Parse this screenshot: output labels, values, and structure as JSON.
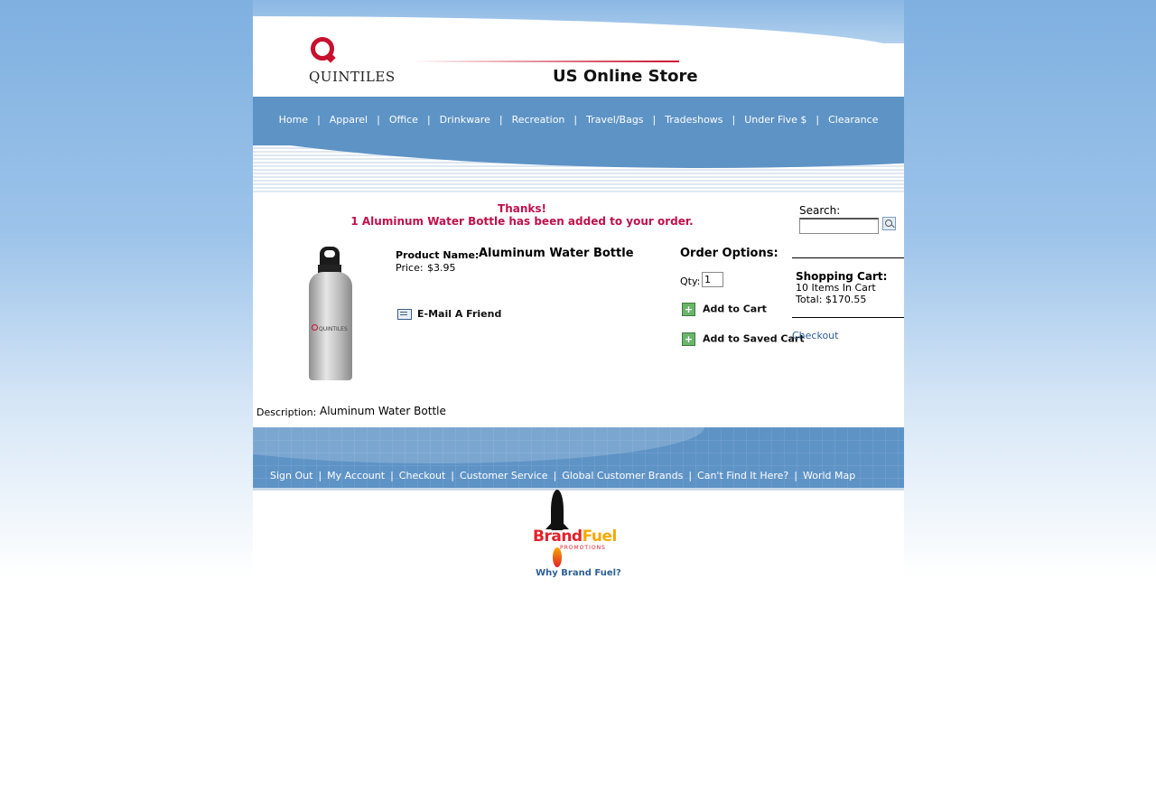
{
  "header": {
    "logo_text": "QUINTILES",
    "store_title": "US Online Store"
  },
  "nav": {
    "items": [
      "Home",
      "Apparel",
      "Office",
      "Drinkware",
      "Recreation",
      "Travel/Bags",
      "Tradeshows",
      "Under Five $",
      "Clearance"
    ],
    "separator": "|"
  },
  "confirmation": {
    "line1": "Thanks!",
    "line2": "1 Aluminum Water Bottle has been added to your order."
  },
  "product": {
    "name_label": "Product Name:",
    "name": "Aluminum Water Bottle",
    "price_label": "Price:",
    "price": "$3.95",
    "image_brand": "QUINTILES",
    "email_friend": "E-Mail A Friend",
    "description_label": "Description:",
    "description": "Aluminum Water Bottle"
  },
  "order_options": {
    "title": "Order Options:",
    "qty_label": "Qty:",
    "qty_value": "1",
    "add_to_cart": "Add to Cart",
    "add_to_saved_cart": "Add to Saved Cart"
  },
  "search": {
    "label": "Search:",
    "value": "",
    "icon": "search-icon"
  },
  "cart": {
    "title": "Shopping Cart:",
    "items": "10 Items In Cart",
    "total": "Total: $170.55",
    "checkout": "Checkout"
  },
  "footer": {
    "items": [
      "Sign Out",
      "My Account",
      "Checkout",
      "Customer Service",
      "Global Customer Brands",
      "Can't Find It Here?",
      "World Map"
    ],
    "separator": "|"
  },
  "brand_fuel": {
    "brand": "Brand",
    "fuel": "Fuel",
    "tagline": "PROMOTIONS",
    "link": "Why Brand Fuel?"
  },
  "colors": {
    "nav_blue": "#5e93c6",
    "confirm_red": "#c0104a",
    "link_blue": "#2d5f95"
  }
}
